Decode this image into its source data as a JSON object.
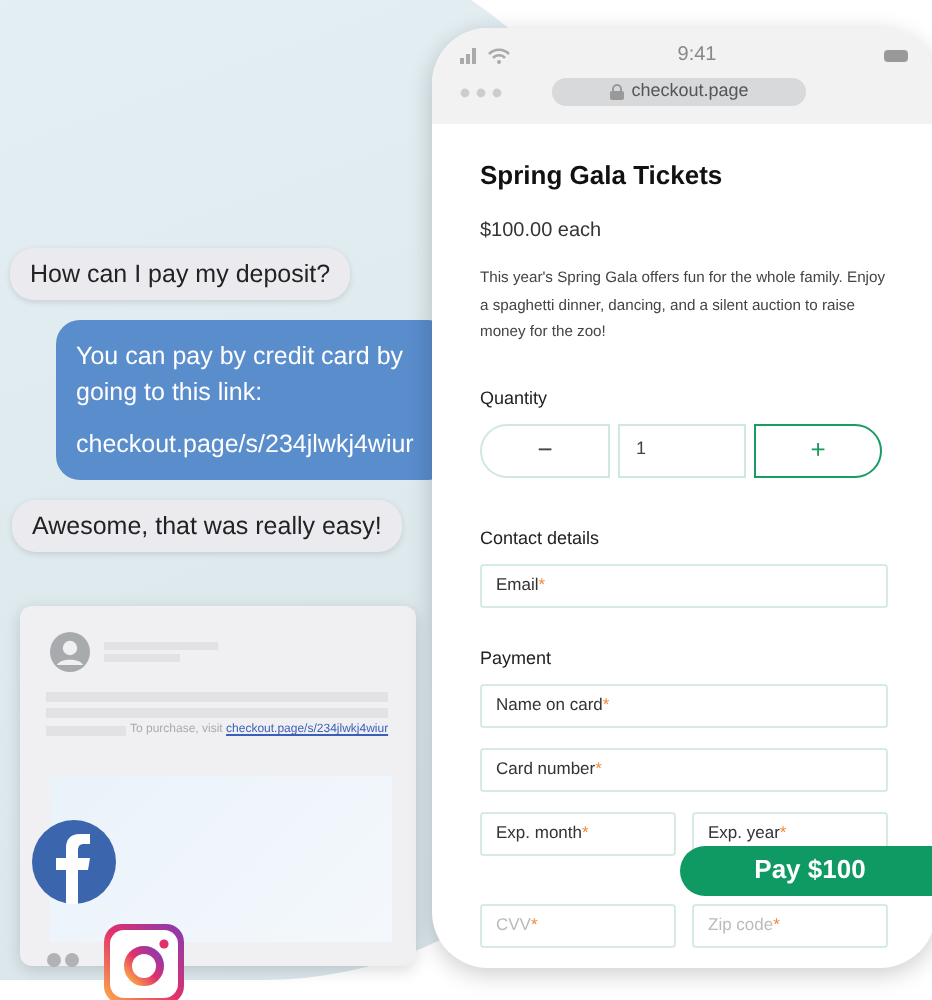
{
  "chat": [
    {
      "kind": "incoming",
      "text": "How can I pay my deposit?"
    },
    {
      "kind": "outgoing",
      "text": "You can pay by credit card by going to this link:",
      "link": "checkout.page/s/234jlwkj4wiur"
    },
    {
      "kind": "incoming",
      "text": "Awesome, that was really easy!"
    }
  ],
  "social_post": {
    "caption": "To purchase, visit",
    "link": "checkout.page/s/234jlwkj4wiur"
  },
  "phone": {
    "time": "9:41",
    "url": "checkout.page"
  },
  "checkout": {
    "title": "Spring Gala Tickets",
    "price": "$100.00 each",
    "description": "This year's Spring Gala offers fun for the whole family. Enjoy a spaghetti dinner, dancing, and a silent auction to raise money for the zoo!",
    "quantity": {
      "label": "Quantity",
      "decrement": "−",
      "value": "1",
      "increment": "+"
    },
    "sections": [
      {
        "heading": "Contact details",
        "rows": [
          [
            {
              "label": "Email",
              "required_mark": "*",
              "disabled": false
            }
          ]
        ]
      },
      {
        "heading": "Payment",
        "rows": [
          [
            {
              "label": "Name on card",
              "required_mark": "*",
              "disabled": false
            }
          ],
          [
            {
              "label": "Card number",
              "required_mark": "*",
              "disabled": false
            }
          ],
          [
            {
              "label": "Exp. month",
              "required_mark": "*",
              "disabled": false
            },
            {
              "label": "Exp. year",
              "required_mark": "*",
              "disabled": false
            }
          ],
          [
            {
              "label": "CVV",
              "required_mark": "*",
              "disabled": true
            },
            {
              "label": "Zip code",
              "required_mark": "*",
              "disabled": true
            }
          ]
        ]
      }
    ],
    "pay_button": "Pay $100"
  }
}
